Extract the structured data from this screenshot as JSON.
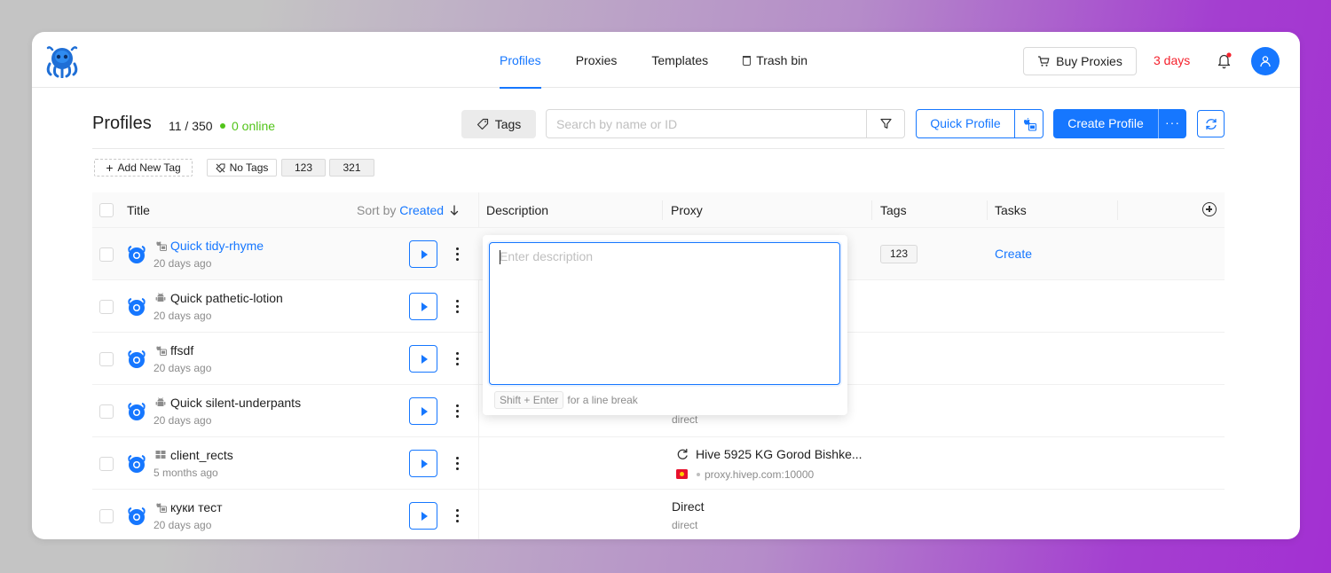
{
  "nav": {
    "items": [
      {
        "label": "Profiles",
        "active": true
      },
      {
        "label": "Proxies",
        "active": false
      },
      {
        "label": "Templates",
        "active": false
      },
      {
        "label": "Trash bin",
        "active": false,
        "icon": "trash-icon"
      }
    ],
    "buy_proxies": "Buy Proxies",
    "trial_days": "3 days",
    "accent_color": "#1677ff",
    "warning_color": "#f5222d"
  },
  "header": {
    "title": "Profiles",
    "count": "11 / 350",
    "online": "0 online",
    "tags_button": "Tags",
    "search_placeholder": "Search by name or ID",
    "quick_profile": "Quick Profile",
    "create_profile": "Create Profile",
    "create_more": "···"
  },
  "tag_filters": {
    "add": "Add New Tag",
    "no_tags": "No Tags",
    "tags": [
      "123",
      "321"
    ]
  },
  "table": {
    "columns": {
      "title": "Title",
      "sort_prefix": "Sort by",
      "sort_value": "Created",
      "description": "Description",
      "proxy": "Proxy",
      "tags": "Tags",
      "tasks": "Tasks"
    },
    "rows": [
      {
        "name": "Quick tidy-rhyme",
        "date": "20 days ago",
        "os": "macos-icon",
        "highlight": true,
        "tag": "123",
        "task": "Create"
      },
      {
        "name": "Quick pathetic-lotion",
        "date": "20 days ago",
        "os": "android-icon"
      },
      {
        "name": "ffsdf",
        "date": "20 days ago",
        "os": "macos-icon"
      },
      {
        "name": "Quick silent-underpants",
        "date": "20 days ago",
        "os": "android-icon",
        "proxy_sub": "direct"
      },
      {
        "name": "client_rects",
        "date": "5 months ago",
        "os": "windows-icon",
        "proxy_title": "Hive 5925 KG Gorod Bishke...",
        "proxy_sub": "proxy.hivep.com:10000"
      },
      {
        "name": "куки тест",
        "date": "20 days ago",
        "os": "macos-icon",
        "proxy_title": "Direct",
        "proxy_sub": "direct"
      }
    ]
  },
  "description_popover": {
    "placeholder": "Enter description",
    "hint_key": "Shift + Enter",
    "hint_text": "for a line break"
  }
}
